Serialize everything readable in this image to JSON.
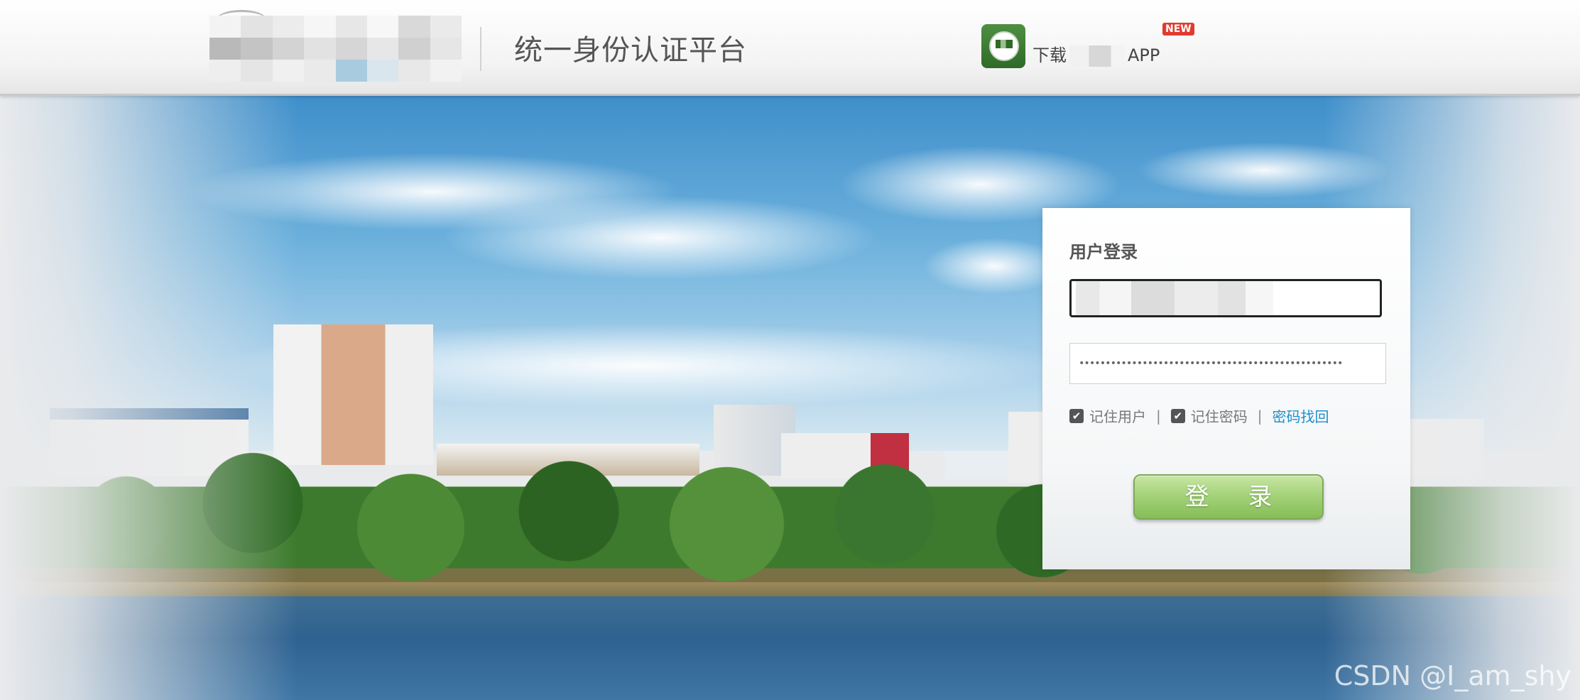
{
  "header": {
    "platform_title": "统一身份认证平台",
    "app_download_prefix": "下载",
    "app_download_suffix": "APP",
    "new_badge": "NEW"
  },
  "login": {
    "title": "用户登录",
    "password_masked": "••••••••••••••••••••••••••••••••••••••••••••••••••",
    "remember_user_label": "记住用户",
    "remember_user_checked": true,
    "remember_password_label": "记住密码",
    "remember_password_checked": true,
    "separator": "|",
    "forgot_password_link": "密码找回",
    "login_button": "登 录"
  },
  "icons": {
    "app": "school-app-icon",
    "checkbox": "checkmark-icon"
  },
  "colors": {
    "link": "#1e8fc9",
    "new_badge": "#e23b2e",
    "login_button": "#a5d37b"
  },
  "watermark": "CSDN @I_am_shy"
}
